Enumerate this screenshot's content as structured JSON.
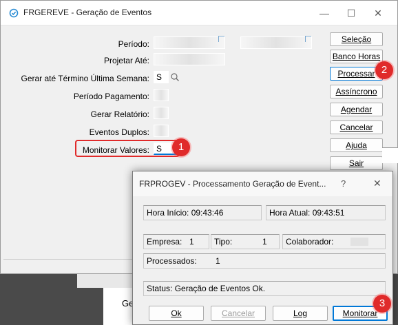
{
  "main_window": {
    "title": "FRGEREVE - Geração de Eventos",
    "controls": {
      "minimize": "—",
      "maximize": "☐",
      "close": "✕"
    },
    "fields": [
      {
        "label": "Período:",
        "value": ""
      },
      {
        "label": "Projetar Até:",
        "value": ""
      },
      {
        "label": "Gerar até Término Última Semana:",
        "value": "S"
      },
      {
        "label": "Período Pagamento:",
        "value": ""
      },
      {
        "label": "Gerar Relatório:",
        "value": ""
      },
      {
        "label": "Eventos Duplos:",
        "value": ""
      },
      {
        "label": "Monitorar Valores:",
        "value": "S"
      }
    ],
    "side_buttons": [
      "Seleção",
      "Banco Horas",
      "Processar",
      "Assíncrono",
      "Agendar",
      "Cancelar",
      "Ajuda",
      "Sair"
    ],
    "background_text": "Ge"
  },
  "dialog": {
    "title": "FRPROGEV - Processamento Geração de Event...",
    "help": "?",
    "close": "✕",
    "hora_inicio": "Hora Início: 09:43:46",
    "hora_atual": "Hora Atual: 09:43:51",
    "empresa_label": "Empresa:",
    "empresa_value": "1",
    "tipo_label": "Tipo:",
    "tipo_value": "1",
    "colaborador_label": "Colaborador:",
    "processados_label": "Processados:",
    "processados_value": "1",
    "status": "Status: Geração de Eventos Ok.",
    "buttons": {
      "ok": "Ok",
      "cancelar": "Cancelar",
      "log": "Log",
      "monitorar": "Monitorar"
    }
  },
  "badges": [
    "1",
    "2",
    "3"
  ],
  "colors": {
    "badge": "#e02a2a",
    "highlight": "#e02a2a",
    "focus": "#0078d7"
  }
}
